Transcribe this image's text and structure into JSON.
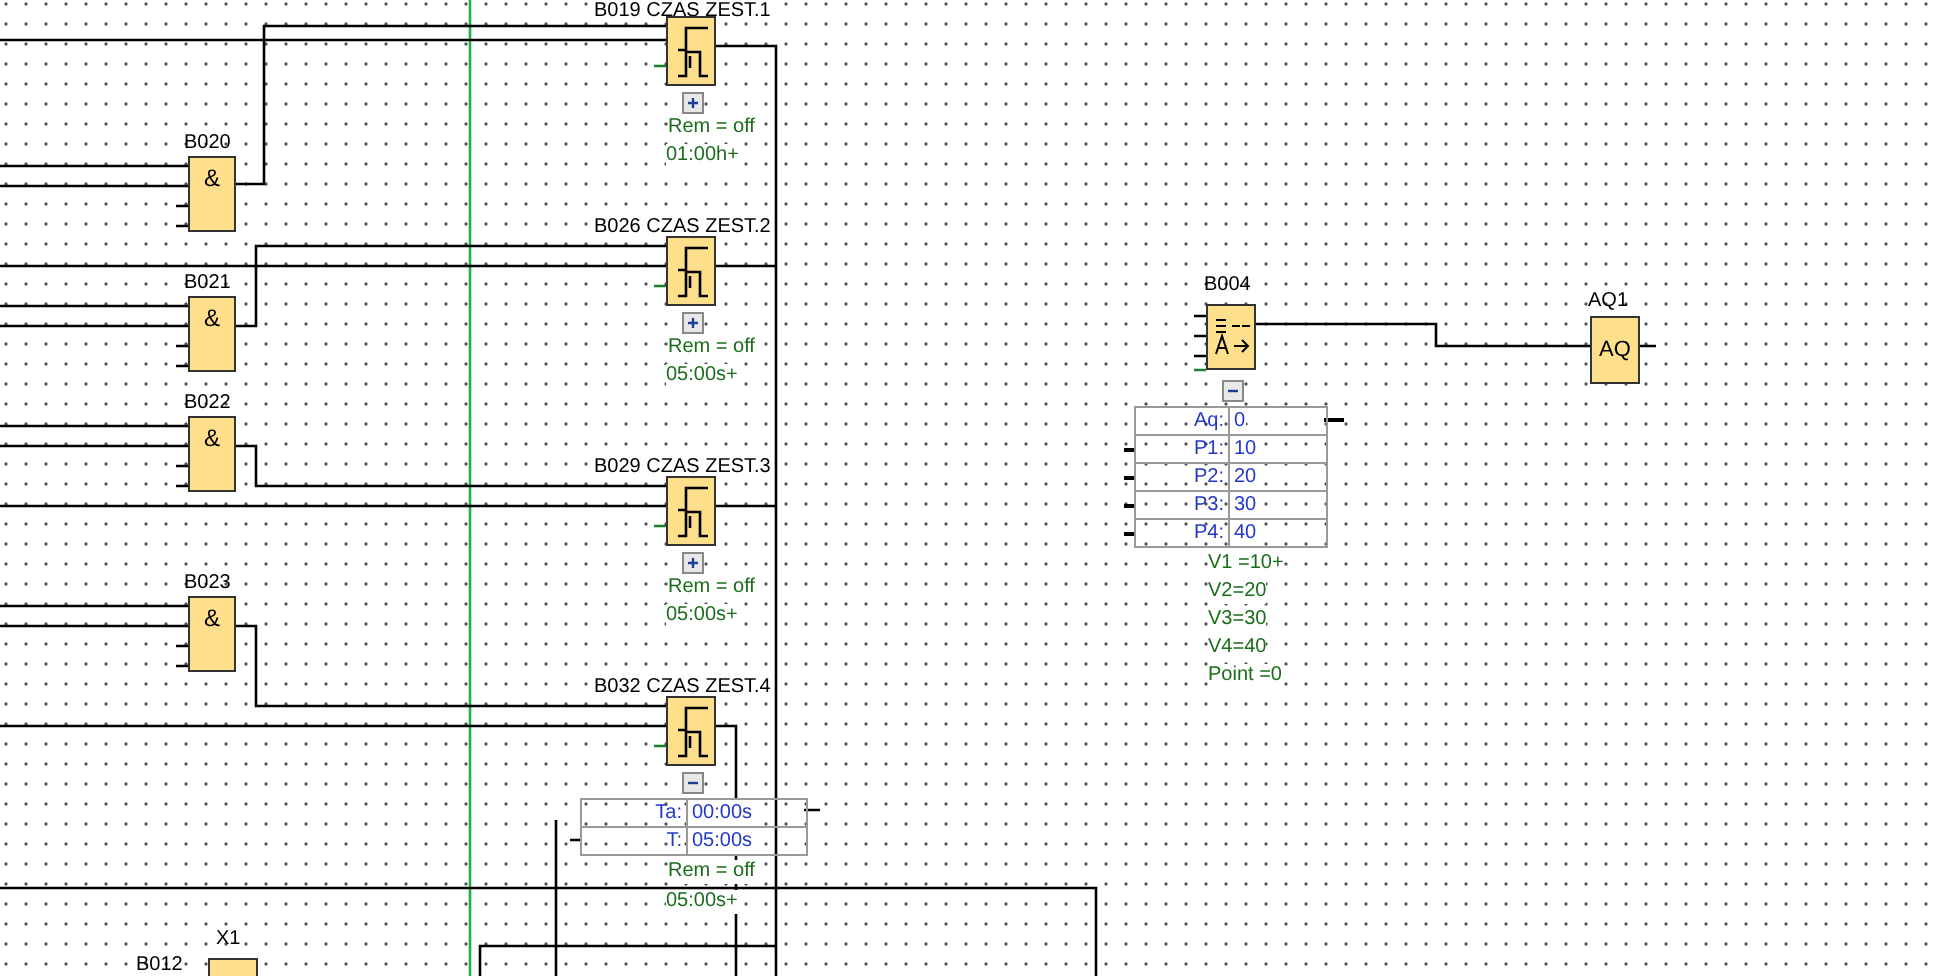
{
  "and_gates": [
    {
      "label": "B020",
      "symbol": "&"
    },
    {
      "label": "B021",
      "symbol": "&"
    },
    {
      "label": "B022",
      "symbol": "&"
    },
    {
      "label": "B023",
      "symbol": "&"
    }
  ],
  "timers": [
    {
      "label": "B019 CZAS ZEST.1",
      "expanded": false,
      "rem": "Rem = off",
      "time": "01:00h+"
    },
    {
      "label": "B026 CZAS ZEST.2",
      "expanded": false,
      "rem": "Rem = off",
      "time": "05:00s+"
    },
    {
      "label": "B029 CZAS ZEST.3",
      "expanded": false,
      "rem": "Rem = off",
      "time": "05:00s+"
    },
    {
      "label": "B032 CZAS ZEST.4",
      "expanded": true,
      "params": [
        {
          "name": "Ta:",
          "value": "00:00s"
        },
        {
          "name": "T:",
          "value": "05:00s"
        }
      ],
      "rem": "Rem = off",
      "time": "05:00s+"
    }
  ],
  "multiplexer": {
    "label": "B004",
    "expanded": true,
    "params": [
      {
        "name": "Aq:",
        "value": "0"
      },
      {
        "name": "P1:",
        "value": "10"
      },
      {
        "name": "P2:",
        "value": "20"
      },
      {
        "name": "P3:",
        "value": "30"
      },
      {
        "name": "P4:",
        "value": "40"
      }
    ],
    "values": [
      "V1 =10+",
      "V2=20",
      "V3=30",
      "V4=40",
      "Point =0"
    ]
  },
  "output": {
    "label": "AQ1",
    "symbol": "AQ"
  },
  "bottom_block": {
    "label": "B012",
    "name": "X1"
  }
}
